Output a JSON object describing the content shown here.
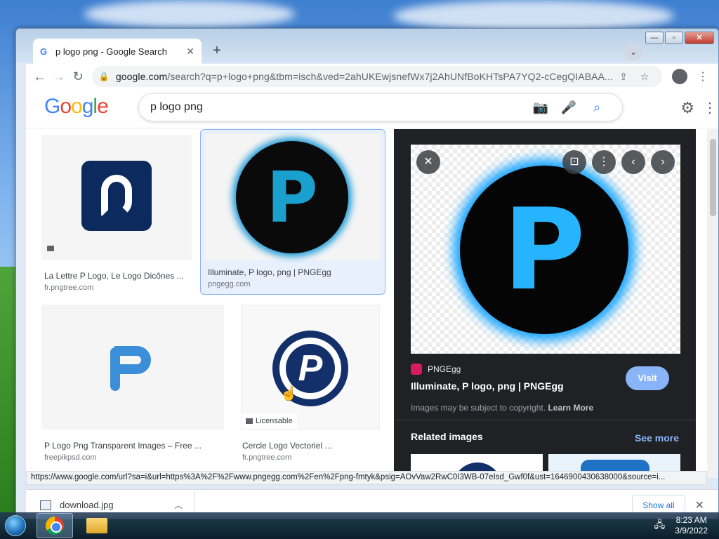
{
  "browser": {
    "tab_title": "p logo png - Google Search",
    "url_host": "google.com",
    "url_rest": "/search?q=p+logo+png&tbm=isch&ved=2ahUKEwjsnefWx7j2AhUNfBoKHTsPA7YQ2-cCegQIABAA..."
  },
  "search": {
    "query": "p logo png"
  },
  "results": [
    {
      "caption": "La Lettre P Logo, Le Logo Dicônes ...",
      "source": "fr.pngtree.com"
    },
    {
      "caption": "Illuminate, P logo, png | PNGEgg",
      "source": "pngegg.com"
    },
    {
      "caption": "P Logo Png Transparent Images – Free ...",
      "source": "freepikpsd.com"
    },
    {
      "caption": "Cercle Logo Vectoriel ...",
      "source": "fr.pngtree.com",
      "badge": "Licensable"
    }
  ],
  "preview": {
    "site_name": "PNGEgg",
    "title": "Illuminate, P logo, png | PNGEgg",
    "visit_label": "Visit",
    "copyright_text": "Images may be subject to copyright.",
    "learn_more": "Learn More",
    "related_heading": "Related images",
    "see_more": "See more"
  },
  "status_url": "https://www.google.com/url?sa=i&url=https%3A%2F%2Fwww.pngegg.com%2Fen%2Fpng-fmtyk&psig=AOvVaw2RwC0I3WB-07eIsd_Gwf0f&ust=1646900430638000&source=i...",
  "downloads": {
    "file_name": "download.jpg",
    "show_all": "Show all"
  },
  "taskbar": {
    "time": "8:23 AM",
    "date": "3/9/2022"
  },
  "colors": {
    "accent": "#8ab4f8",
    "preview_bg": "#202124",
    "link_blue": "#1a73e8"
  }
}
